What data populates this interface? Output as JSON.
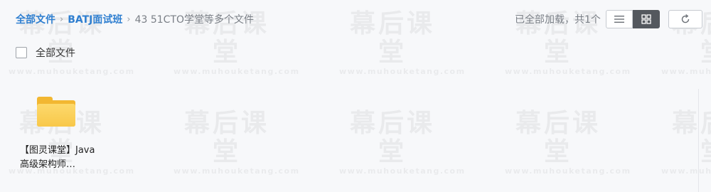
{
  "breadcrumb": {
    "items": [
      "全部文件",
      "BATJ面试班"
    ],
    "current": "43 51CTO学堂等多个文件",
    "separator": "›"
  },
  "status": {
    "load_text": "已全部加载，共1个"
  },
  "toolbar": {
    "list_view_icon": "list-icon",
    "grid_view_icon": "grid-icon",
    "refresh_icon": "refresh-icon",
    "active_view": "grid"
  },
  "selection": {
    "select_all_label": "全部文件"
  },
  "files": [
    {
      "name": "【图灵课堂】Java高级架构师…",
      "icon": "folder-icon"
    }
  ],
  "watermark": {
    "big": "幕后课堂",
    "small": "www.muhouketang.com"
  },
  "colors": {
    "link": "#2f7fd0",
    "folder": "#f8c84a",
    "active_toggle": "#54585e"
  }
}
